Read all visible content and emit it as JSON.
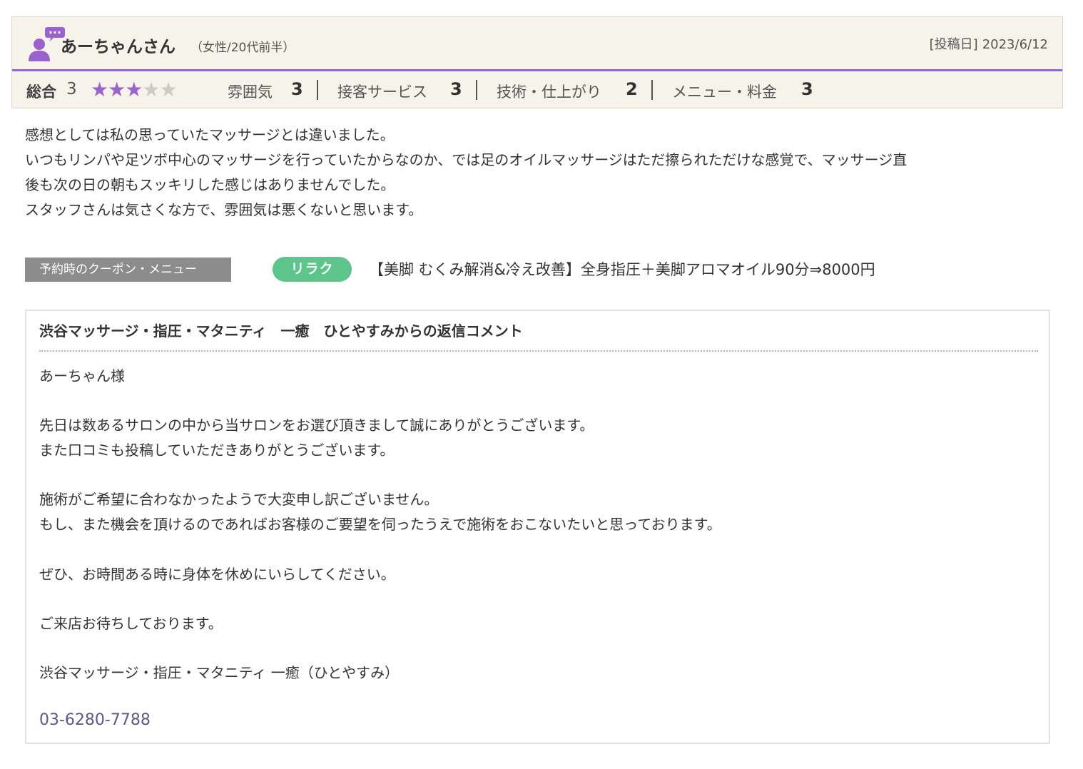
{
  "review": {
    "reviewer_name": "あーちゃんさん",
    "reviewer_meta": "（女性/20代前半）",
    "post_date_label": "[投稿日]",
    "post_date": "2023/6/12",
    "avatar_icon": "user-comment-icon",
    "accent_color": "#9a62cd",
    "overall_label": "総合",
    "overall_score": "3",
    "stars": {
      "filled": 3,
      "total": 5,
      "filled_color": "#9a62cd",
      "empty_color": "#cfcac0"
    },
    "categories": [
      {
        "label": "雰囲気",
        "score": "3"
      },
      {
        "label": "接客サービス",
        "score": "3"
      },
      {
        "label": "技術・仕上がり",
        "score": "2"
      },
      {
        "label": "メニュー・料金",
        "score": "3"
      }
    ],
    "body_lines": [
      "感想としては私の思っていたマッサージとは違いました。",
      "いつもリンパや足ツボ中心のマッサージを行っていたからなのか、では足のオイルマッサージはただ擦られただけな感覚で、マッサージ直",
      "後も次の日の朝もスッキリした感じはありませんでした。",
      "スタッフさんは気さくな方で、雰囲気は悪くないと思います。"
    ]
  },
  "coupon": {
    "label": "予約時のクーポン・メニュー",
    "badge": "リラク",
    "badge_color": "#5dc48c",
    "text": "【美脚 むくみ解消&冷え改善】全身指圧＋美脚アロマオイル90分⇒8000円"
  },
  "reply": {
    "title": "渋谷マッサージ・指圧・マタニティ　一癒　ひとやすみからの返信コメント",
    "lines": [
      "あーちゃん様",
      "",
      "先日は数あるサロンの中から当サロンをお選び頂きまして誠にありがとうございます。",
      "また口コミも投稿していただきありがとうございます。",
      "",
      "施術がご希望に合わなかったようで大変申し訳ございません。",
      "もし、また機会を頂けるのであればお客様のご要望を伺ったうえで施術をおこないたいと思っております。",
      "",
      "ぜひ、お時間ある時に身体を休めにいらしてください。",
      "",
      "ご来店お待ちしております。",
      "",
      "渋谷マッサージ・指圧・マタニティ 一癒（ひとやすみ）"
    ],
    "phone": "03-6280-7788",
    "phone_color": "#5a5890"
  }
}
